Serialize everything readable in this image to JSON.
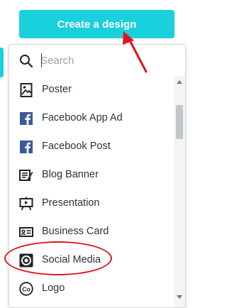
{
  "header": {
    "create_button_label": "Create a design",
    "accent_color": "#1ad0dc"
  },
  "search": {
    "placeholder": "Search",
    "value": ""
  },
  "menu": {
    "items": [
      {
        "label": "Poster",
        "icon": "poster-icon"
      },
      {
        "label": "Facebook App Ad",
        "icon": "facebook-icon"
      },
      {
        "label": "Facebook Post",
        "icon": "facebook-icon"
      },
      {
        "label": "Blog Banner",
        "icon": "blog-banner-icon"
      },
      {
        "label": "Presentation",
        "icon": "presentation-icon"
      },
      {
        "label": "Business Card",
        "icon": "business-card-icon"
      },
      {
        "label": "Social Media",
        "icon": "social-media-icon"
      },
      {
        "label": "Logo",
        "icon": "logo-icon"
      }
    ]
  },
  "annotation": {
    "color": "#e2141b",
    "highlighted_item": "Social Media"
  }
}
